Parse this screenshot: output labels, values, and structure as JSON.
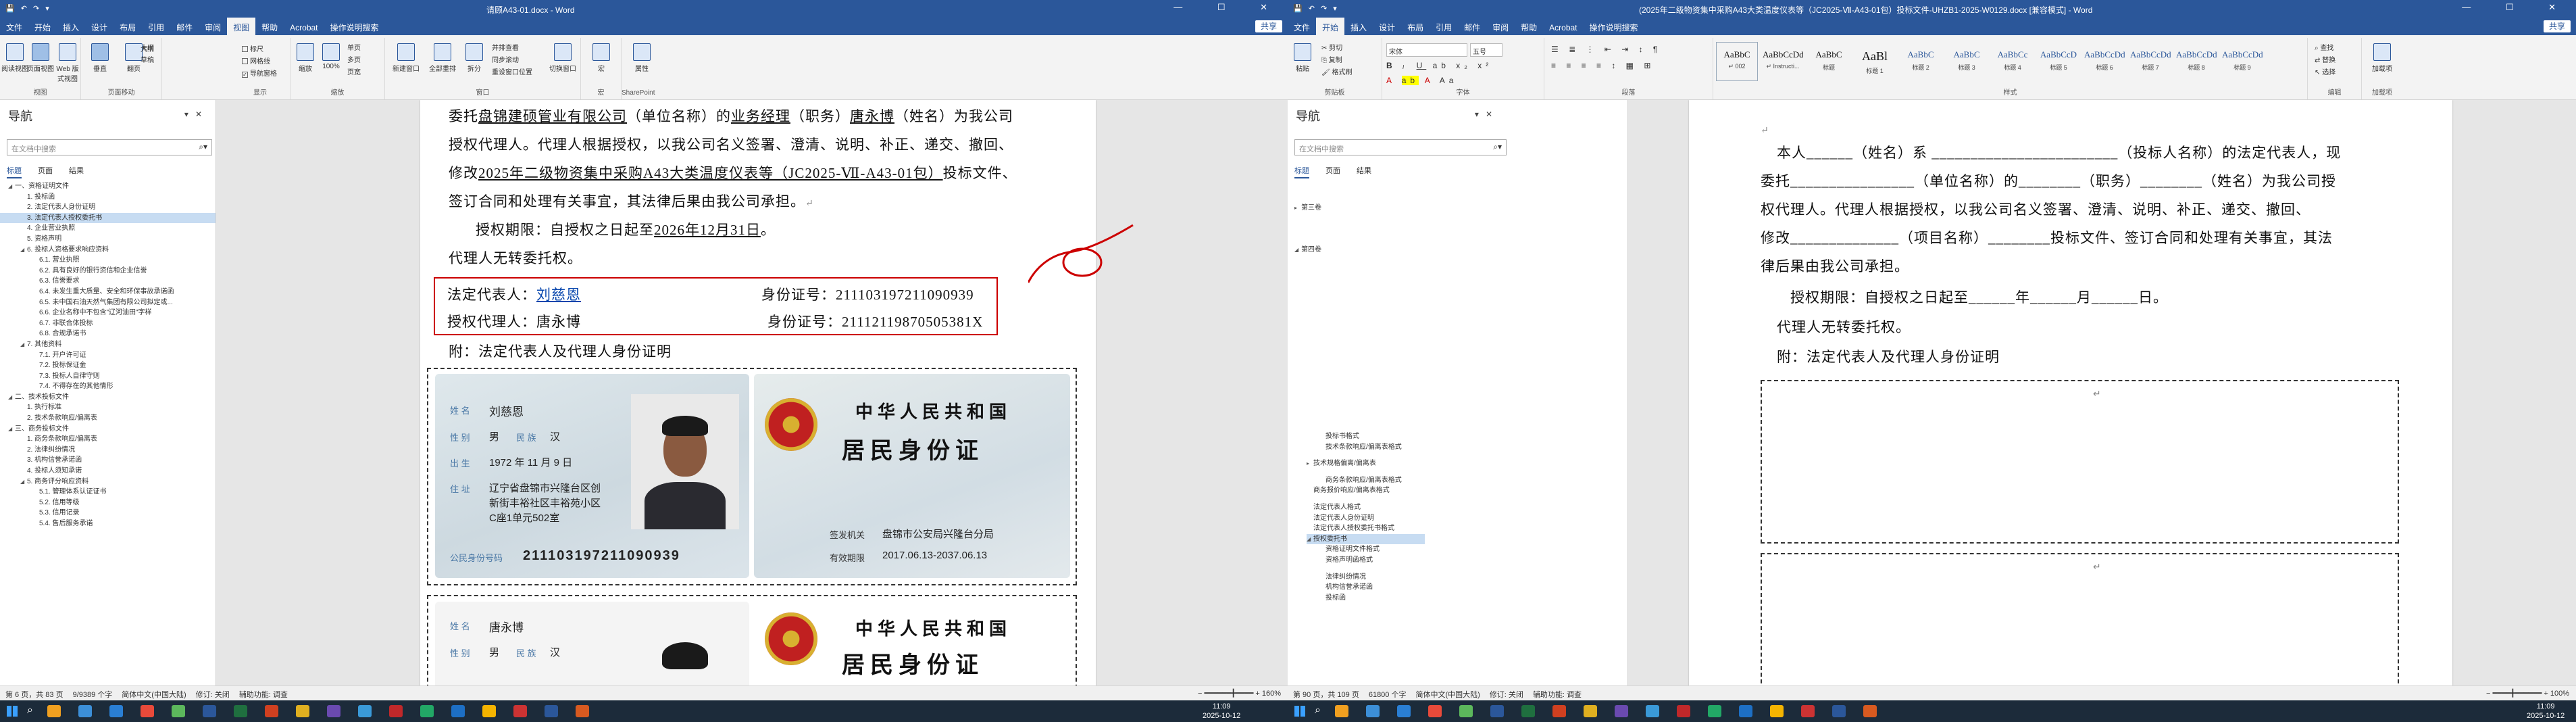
{
  "left": {
    "title": "请顾A43-01.docx - Word",
    "tabs": [
      "文件",
      "开始",
      "插入",
      "设计",
      "布局",
      "引用",
      "邮件",
      "审阅",
      "视图",
      "帮助",
      "Acrobat",
      "操作说明搜索"
    ],
    "active_tab": "视图",
    "share": "共享",
    "ribbon": {
      "groups": [
        "视图",
        "页面移动",
        "显示",
        "缩放",
        "窗口",
        "宏",
        "SharePoint"
      ],
      "view_buttons": [
        "阅读视图",
        "页面视图",
        "Web 版式视图"
      ],
      "view_options": [
        "大纲",
        "草稿"
      ],
      "page_move": [
        "垂直",
        "翻页"
      ],
      "show": [
        "标尺",
        "网格线",
        "导航窗格"
      ],
      "zoom": [
        "缩放",
        "100%",
        "单页",
        "多页",
        "页宽"
      ],
      "window": [
        "新建窗口",
        "全部重排",
        "拆分",
        "并排查看",
        "同步滚动",
        "重设窗口位置",
        "切换窗口"
      ],
      "macro": "宏",
      "props": "属性"
    },
    "nav": {
      "title": "导航",
      "search_placeholder": "在文档中搜索",
      "tabs": [
        "标题",
        "页面",
        "结果"
      ],
      "items": [
        {
          "t": "一、资格证明文件",
          "lv": 0,
          "tg": "◢"
        },
        {
          "t": "1. 投标函",
          "lv": 1,
          "tg": ""
        },
        {
          "t": "2. 法定代表人身份证明",
          "lv": 1,
          "tg": ""
        },
        {
          "t": "3. 法定代表人授权委托书",
          "lv": 1,
          "tg": "",
          "hl": true
        },
        {
          "t": "4. 企业营业执照",
          "lv": 1,
          "tg": ""
        },
        {
          "t": "5. 资格声明",
          "lv": 1,
          "tg": ""
        },
        {
          "t": "6. 投标人资格要求响应资料",
          "lv": 1,
          "tg": "◢"
        },
        {
          "t": "6.1. 营业执照",
          "lv": 2,
          "tg": ""
        },
        {
          "t": "6.2. 具有良好的银行资信和企业信誉",
          "lv": 2,
          "tg": ""
        },
        {
          "t": "6.3. 信誉要求",
          "lv": 2,
          "tg": ""
        },
        {
          "t": "6.4. 未发生重大质量、安全和环保事故承诺函",
          "lv": 2,
          "tg": ""
        },
        {
          "t": "6.5. 未中国石油天然气集团有限公司拟定或...",
          "lv": 2,
          "tg": ""
        },
        {
          "t": "6.6. 企业名称中不包含\"辽河油田\"字样",
          "lv": 2,
          "tg": ""
        },
        {
          "t": "6.7. 非联合体投标",
          "lv": 2,
          "tg": ""
        },
        {
          "t": "6.8. 合规承诺书",
          "lv": 2,
          "tg": ""
        },
        {
          "t": "7. 其他资料",
          "lv": 1,
          "tg": "◢"
        },
        {
          "t": "7.1. 开户许可证",
          "lv": 2,
          "tg": ""
        },
        {
          "t": "7.2. 投标保证金",
          "lv": 2,
          "tg": ""
        },
        {
          "t": "7.3. 投标人自律守则",
          "lv": 2,
          "tg": ""
        },
        {
          "t": "7.4. 不得存在的其他情形",
          "lv": 2,
          "tg": ""
        },
        {
          "t": "二、技术投标文件",
          "lv": 0,
          "tg": "◢"
        },
        {
          "t": "1. 执行标准",
          "lv": 1,
          "tg": ""
        },
        {
          "t": "2. 技术条款响应/偏离表",
          "lv": 1,
          "tg": ""
        },
        {
          "t": "三、商务投标文件",
          "lv": 0,
          "tg": "◢"
        },
        {
          "t": "1. 商务条款响应/偏离表",
          "lv": 1,
          "tg": ""
        },
        {
          "t": "2. 法律纠纷情况",
          "lv": 1,
          "tg": ""
        },
        {
          "t": "3. 机构信誉承诺函",
          "lv": 1,
          "tg": ""
        },
        {
          "t": "4. 投标人须知承诺",
          "lv": 1,
          "tg": ""
        },
        {
          "t": "5. 商务评分响应资料",
          "lv": 1,
          "tg": "◢"
        },
        {
          "t": "5.1. 管理体系认证证书",
          "lv": 2,
          "tg": ""
        },
        {
          "t": "5.2. 信用等级",
          "lv": 2,
          "tg": ""
        },
        {
          "t": "5.3. 信用记录",
          "lv": 2,
          "tg": ""
        },
        {
          "t": "5.4. 售后服务承诺",
          "lv": 2,
          "tg": ""
        }
      ]
    },
    "doc": {
      "line1_pre": "委托",
      "company": "盘锦建硕管业有限公司",
      "unit_label": "（单位名称）的",
      "position": "业务经理",
      "pos_label": "（职务）",
      "agent": "唐永博",
      "name_label": "（姓名）为我公司",
      "line2": "授权代理人。代理人根据授权，以我公司名义签署、澄清、说明、补正、递交、撤回、",
      "line3_pre": "修改",
      "project": "2025年二级物资集中采购A43大类温度仪表等（JC2025-Ⅶ-A43-01包）",
      "line3_post": "投标文件、",
      "line4": "签订合同和处理有关事宜，其法律后果由我公司承担。",
      "period_pre": "授权期限：自授权之日起至",
      "period_date": "2026年12月31日",
      "period_end": "。",
      "no_sub": "代理人无转委托权。",
      "legal_label": "法定代表人：",
      "legal_name": "刘慈恩",
      "id_label": "身份证号：",
      "legal_id": "211103197211090939",
      "agent_label": "授权代理人：",
      "agent_name": "唐永博",
      "agent_id": "21112119870505381X",
      "attach": "附：法定代表人及代理人身份证明",
      "card1": {
        "name_label": "姓 名",
        "name": "刘慈恩",
        "sex_label": "性 别",
        "sex": "男",
        "nation_label": "民 族",
        "nation": "汉",
        "birth_label": "出 生",
        "birth": "1972 年 11 月 9 日",
        "addr_label": "住 址",
        "addr1": "辽宁省盘锦市兴隆台区创",
        "addr2": "新街丰裕社区丰裕苑小区",
        "addr3": "C座1单元502室",
        "id_label": "公民身份号码",
        "id": "211103197211090939"
      },
      "card1_back": {
        "country": "中华人民共和国",
        "doc": "居民身份证",
        "issuer_label": "签发机关",
        "issuer": "盘锦市公安局兴隆台分局",
        "valid_label": "有效期限",
        "valid": "2017.06.13-2037.06.13"
      },
      "card2": {
        "name_label": "姓 名",
        "name": "唐永博",
        "sex_label": "性 别",
        "sex": "男",
        "nation_label": "民 族",
        "nation": "汉"
      },
      "card2_back": {
        "country": "中华人民共和国",
        "doc": "居民身份证"
      }
    },
    "status": [
      "第 6 页，共 83 页",
      "9/9389 个字",
      "简体中文(中国大陆)",
      "修订: 关闭",
      "辅助功能: 调查"
    ],
    "zoom": "160%"
  },
  "right": {
    "title": "(2025年二级物资集中采购A43大类温度仪表等（JC2025-Ⅶ-A43-01包）投标文件-UHZB1-2025-W0129.docx [兼容模式] - Word",
    "tabs": [
      "文件",
      "开始",
      "插入",
      "设计",
      "布局",
      "引用",
      "邮件",
      "审阅",
      "帮助",
      "Acrobat",
      "操作说明搜索"
    ],
    "active_tab": "开始",
    "share": "共享",
    "ribbon": {
      "groups": [
        "剪贴板",
        "字体",
        "段落",
        "样式",
        "编辑",
        "加载项"
      ],
      "clipboard": [
        "粘贴",
        "剪切",
        "复制",
        "格式刷"
      ],
      "font_name": "宋体",
      "font_size": "五号",
      "styles": [
        {
          "p": "AaBbC",
          "n": "↵ 002"
        },
        {
          "p": "AaBbCcDd",
          "n": "↵ Instructi..."
        },
        {
          "p": "AaBbC",
          "n": "标题"
        },
        {
          "p": "AaBl",
          "n": "标题 1"
        },
        {
          "p": "AaBbC",
          "n": "标题 2"
        },
        {
          "p": "AaBbC",
          "n": "标题 3"
        },
        {
          "p": "AaBbCc",
          "n": "标题 4"
        },
        {
          "p": "AaBbCcD",
          "n": "标题 5"
        },
        {
          "p": "AaBbCcDd",
          "n": "标题 6"
        },
        {
          "p": "AaBbCcDd",
          "n": "标题 7"
        },
        {
          "p": "AaBbCcDd",
          "n": "标题 8"
        },
        {
          "p": "AaBbCcDd",
          "n": "标题 9"
        }
      ],
      "editing": [
        "查找",
        "替换",
        "选择"
      ],
      "addin": "加载项"
    },
    "nav": {
      "title": "导航",
      "search_placeholder": "在文档中搜索",
      "tabs": [
        "标题",
        "页面",
        "结果"
      ],
      "top_items": [
        "第三卷",
        "第四卷"
      ],
      "items": [
        {
          "t": "投标书格式",
          "lv": 1
        },
        {
          "t": "技术条款响应/偏离表格式",
          "lv": 1
        },
        {
          "t": "技术规格偏离/偏离表",
          "lv": 0,
          "tg": "▸"
        },
        {
          "t": "商务条款响应/偏离表格式",
          "lv": 1
        },
        {
          "t": "商务报价响应/偏离表格式",
          "lv": 0
        },
        {
          "t": "法定代表人格式",
          "lv": 0
        },
        {
          "t": "法定代表人身份证明",
          "lv": 0
        },
        {
          "t": "法定代表人授权委托书格式",
          "lv": 0
        },
        {
          "t": "授权委托书",
          "lv": 0,
          "tg": "◢",
          "hl": true
        },
        {
          "t": "资格证明文件格式",
          "lv": 1
        },
        {
          "t": "资格声明函格式",
          "lv": 1
        },
        {
          "t": "法律纠纷情况",
          "lv": 1
        },
        {
          "t": "机构信誉承诺函",
          "lv": 1
        },
        {
          "t": "投标函",
          "lv": 1
        }
      ]
    },
    "doc": {
      "p1": "本人______（姓名）系 ________________________（投标人名称）的法定代表人，现",
      "p2": "委托________________（单位名称）的________（职务）________（姓名）为我公司授",
      "p3": "权代理人。代理人根据授权，以我公司名义签署、澄清、说明、补正、递交、撤回、",
      "p4": "修改______________（项目名称）________投标文件、签订合同和处理有关事宜，其法",
      "p5": "律后果由我公司承担。",
      "period": "授权期限：自授权之日起至______年______月______日。",
      "no_sub": "代理人无转委托权。",
      "attach": "附：法定代表人及代理人身份证明"
    },
    "status": [
      "第 90 页，共 109 页",
      "61800 个字",
      "简体中文(中国大陆)",
      "修订: 关闭",
      "辅助功能: 调查"
    ],
    "zoom": "100%"
  },
  "taskbar": {
    "time_left": "11:09",
    "date_left": "2025-10-12",
    "time_right": "11:09",
    "date_right": "2025-10-12"
  }
}
